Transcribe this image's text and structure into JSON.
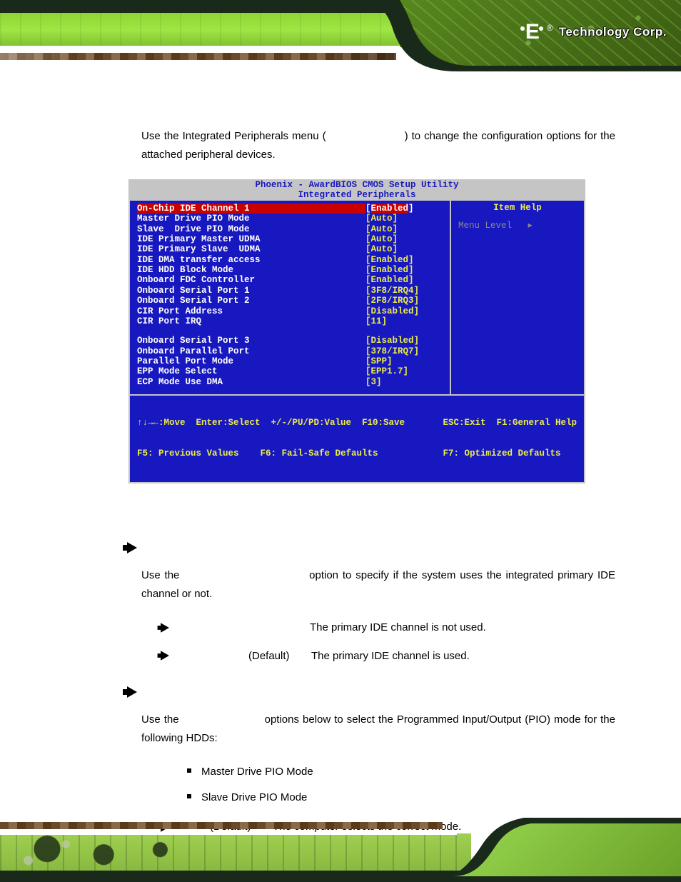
{
  "brand": {
    "mark": "iEi",
    "registered": "®",
    "line1": "Technology",
    "line2": "Corp."
  },
  "intro": {
    "pre": "Use the Integrated Peripherals menu (",
    "post": ") to change the configuration options for the attached peripheral devices."
  },
  "bios": {
    "title_line1": "Phoenix - AwardBIOS CMOS Setup Utility",
    "title_line2": "Integrated Peripherals",
    "help_head": "Item Help",
    "help_body": "Menu Level",
    "help_arrow": "▸",
    "rows": [
      {
        "label": "On-Chip IDE Channel 1",
        "value": "[Enabled]",
        "selected": true
      },
      {
        "label": "Master Drive PIO Mode",
        "value": "[Auto]"
      },
      {
        "label": "Slave  Drive PIO Mode",
        "value": "[Auto]"
      },
      {
        "label": "IDE Primary Master UDMA",
        "value": "[Auto]"
      },
      {
        "label": "IDE Primary Slave  UDMA",
        "value": "[Auto]"
      },
      {
        "label": "IDE DMA transfer access",
        "value": "[Enabled]"
      },
      {
        "label": "IDE HDD Block Mode",
        "value": "[Enabled]"
      },
      {
        "label": "Onboard FDC Controller",
        "value": "[Enabled]"
      },
      {
        "label": "Onboard Serial Port 1",
        "value": "[3F8/IRQ4]"
      },
      {
        "label": "Onboard Serial Port 2",
        "value": "[2F8/IRQ3]"
      },
      {
        "label": "CIR Port Address",
        "value": "[Disabled]"
      },
      {
        "label": "CIR Port IRQ",
        "value": "[11]"
      }
    ],
    "rows2": [
      {
        "label": "Onboard Serial Port 3",
        "value": "[Disabled]"
      },
      {
        "label": "Onboard Parallel Port",
        "value": "[378/IRQ7]"
      },
      {
        "label": "Parallel Port Mode",
        "value": "[SPP]"
      },
      {
        "label": "EPP Mode Select",
        "value": "[EPP1.7]"
      },
      {
        "label": "ECP Mode Use DMA",
        "value": "[3]"
      }
    ],
    "foot_left_1": "↑↓→←:Move  Enter:Select  +/-/PU/PD:Value  F10:Save",
    "foot_left_2": "F5: Previous Values    F6: Fail-Safe Defaults",
    "foot_right_1": "ESC:Exit  F1:General Help",
    "foot_right_2": "F7: Optimized Defaults"
  },
  "section1": {
    "body_pre": "Use the ",
    "body_post": " option to specify if the system uses the integrated primary IDE channel or not.",
    "opt1_desc": "The primary IDE channel is not used.",
    "opt2_default": "(Default)",
    "opt2_desc": "The primary IDE channel is used."
  },
  "section2": {
    "body_pre": "Use the ",
    "body_post": " options below to select the Programmed Input/Output (PIO) mode for the following HDDs:",
    "bullet1": "Master Drive PIO Mode",
    "bullet2": "Slave Drive PIO Mode",
    "opt_default": "(Default)",
    "opt_desc": "The computer selects the correct mode."
  }
}
